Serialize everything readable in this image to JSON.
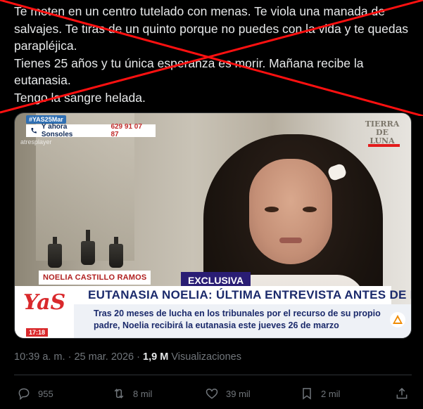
{
  "tweet": {
    "lines": [
      "Te meten en un centro tutelado con menas. Te viola una manada de",
      "salvajes. Te tiras de un quinto porque no puedes con la vida y te quedas",
      "parapléjica.",
      "Tienes 25 años y tu única esperanza es morir. Mañana recibe la",
      "eutanasia.",
      "Tengo la sangre helada."
    ],
    "strike_color": "#ff1010"
  },
  "media": {
    "hashtag": "#YAS25Mar",
    "phone_label": "Y ahora Sonsoles",
    "phone_number": "629 91 07 87",
    "network_logo": "atresplayer",
    "show_logo": "TIERRA DE LUNA",
    "name_tag": "NOELIA CASTILLO RAMOS",
    "exclusive_tag": "EXCLUSIVA",
    "logo_text": "YaS",
    "logo_time": "17:18",
    "headline": "EUTANASIA NOELIA: ÚLTIMA ENTREVISTA ANTES DE MORIR",
    "subheadline": [
      "Tras 20 meses de lucha en los tribunales por el recurso de su propio",
      "padre, Noelia recibirá la eutanasia este jueves 26 de marzo"
    ]
  },
  "meta": {
    "time": "10:39 a. m.",
    "separator": "·",
    "date": "25 mar. 2026",
    "views_count": "1,9 M",
    "views_label": "Visualizaciones"
  },
  "actions": {
    "replies": "955",
    "reposts": "8 mil",
    "likes": "39 mil",
    "bookmarks": "2 mil"
  },
  "icons": {
    "reply": "reply-icon",
    "repost": "repost-icon",
    "like": "heart-icon",
    "bookmark": "bookmark-icon",
    "share": "share-icon"
  }
}
